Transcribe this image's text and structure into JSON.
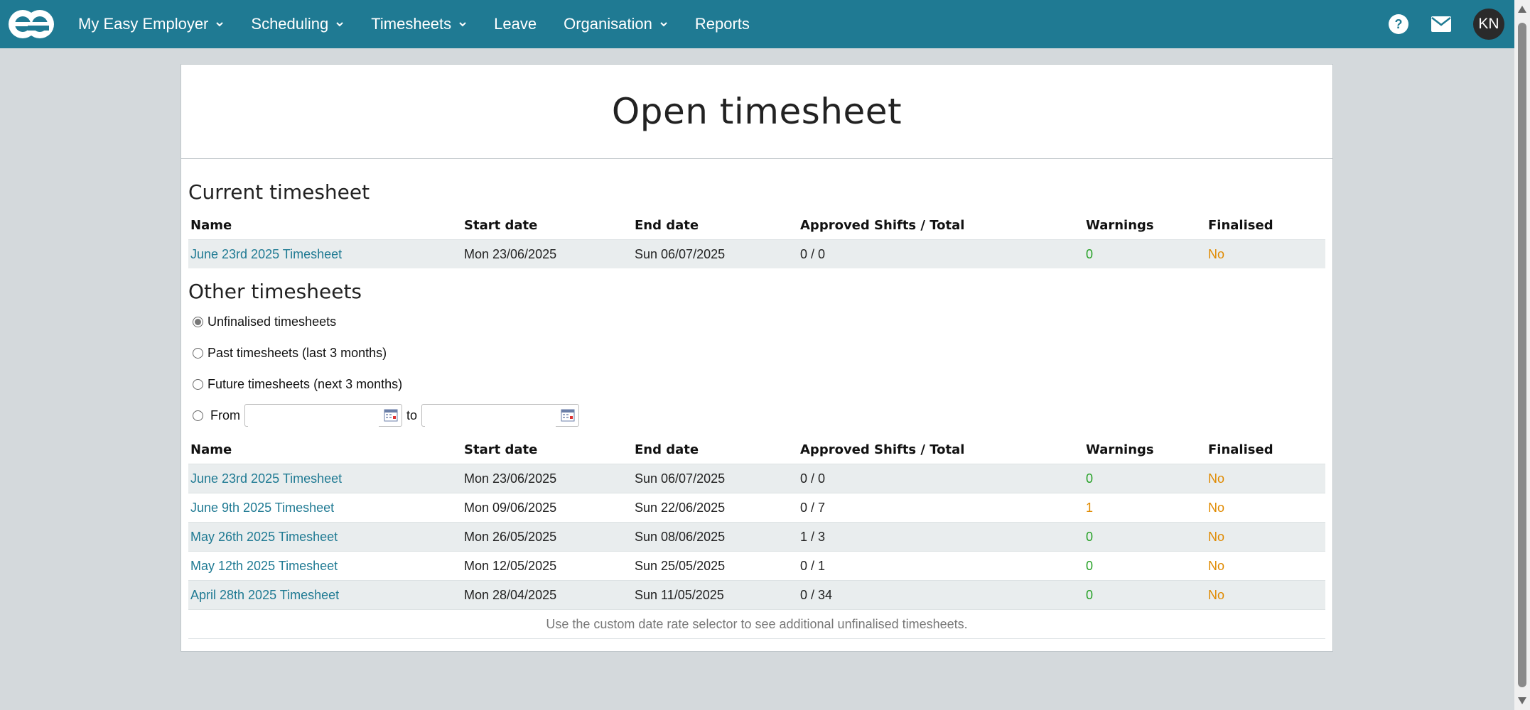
{
  "nav": {
    "items": [
      {
        "label": "My Easy Employer",
        "dropdown": true
      },
      {
        "label": "Scheduling",
        "dropdown": true
      },
      {
        "label": "Timesheets",
        "dropdown": true
      },
      {
        "label": "Leave",
        "dropdown": false
      },
      {
        "label": "Organisation",
        "dropdown": true
      },
      {
        "label": "Reports",
        "dropdown": false
      }
    ],
    "avatar_initials": "KN",
    "icons": [
      "help-icon",
      "mail-icon"
    ]
  },
  "page": {
    "title": "Open timesheet"
  },
  "columns": [
    "Name",
    "Start date",
    "End date",
    "Approved Shifts / Total",
    "Warnings",
    "Finalised"
  ],
  "current": {
    "title": "Current timesheet",
    "rows": [
      {
        "name": "June 23rd 2025 Timesheet",
        "start": "Mon 23/06/2025",
        "end": "Sun 06/07/2025",
        "approved": "0 / 0",
        "warnings": "0",
        "finalised": "No"
      }
    ]
  },
  "other": {
    "title": "Other timesheets",
    "filters": [
      {
        "label": "Unfinalised timesheets",
        "checked": true
      },
      {
        "label": "Past timesheets (last 3 months)",
        "checked": false
      },
      {
        "label": "Future timesheets (next 3 months)",
        "checked": false
      }
    ],
    "range": {
      "from_label": "From",
      "to_label": "to",
      "from_value": "",
      "to_value": ""
    },
    "rows": [
      {
        "name": "June 23rd 2025 Timesheet",
        "start": "Mon 23/06/2025",
        "end": "Sun 06/07/2025",
        "approved": "0 / 0",
        "warnings": "0",
        "finalised": "No"
      },
      {
        "name": "June 9th 2025 Timesheet",
        "start": "Mon 09/06/2025",
        "end": "Sun 22/06/2025",
        "approved": "0 / 7",
        "warnings": "1",
        "finalised": "No"
      },
      {
        "name": "May 26th 2025 Timesheet",
        "start": "Mon 26/05/2025",
        "end": "Sun 08/06/2025",
        "approved": "1 / 3",
        "warnings": "0",
        "finalised": "No"
      },
      {
        "name": "May 12th 2025 Timesheet",
        "start": "Mon 12/05/2025",
        "end": "Sun 25/05/2025",
        "approved": "0 / 1",
        "warnings": "0",
        "finalised": "No"
      },
      {
        "name": "April 28th 2025 Timesheet",
        "start": "Mon 28/04/2025",
        "end": "Sun 11/05/2025",
        "approved": "0 / 34",
        "warnings": "0",
        "finalised": "No"
      }
    ],
    "footnote": "Use the custom date rate selector to see additional unfinalised timesheets."
  },
  "colors": {
    "header_bg": "#1f7a93",
    "link": "#1f7a93",
    "ok": "#27a127",
    "warn": "#e08a00"
  }
}
